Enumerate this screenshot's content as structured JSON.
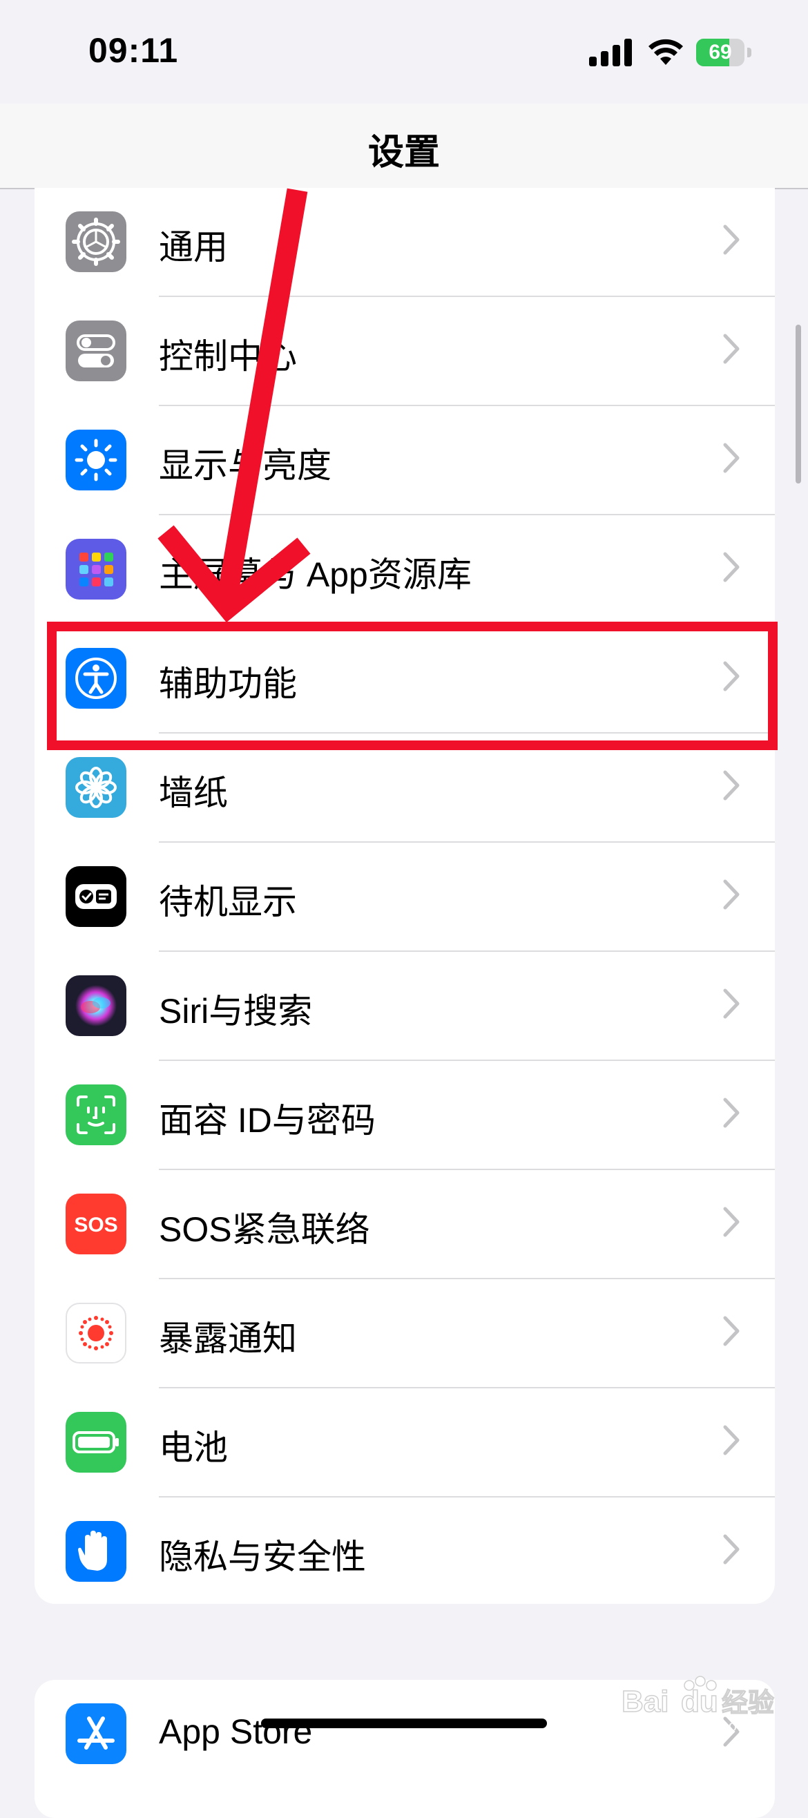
{
  "status_bar": {
    "time": "09:11",
    "battery_percent": "69",
    "battery_level": 0.69
  },
  "nav": {
    "title": "设置"
  },
  "settings_items": [
    {
      "label": "通用",
      "icon": "gear-icon",
      "icon_bg": "#8e8e93"
    },
    {
      "label": "控制中心",
      "icon": "toggle-switches-icon",
      "icon_bg": "#8e8e93"
    },
    {
      "label": "显示与亮度",
      "icon": "sun-icon",
      "icon_bg": "#007aff"
    },
    {
      "label": "主屏幕与 App资源库",
      "icon": "app-grid-icon",
      "icon_bg": "#5e5ce6"
    },
    {
      "label": "辅助功能",
      "icon": "accessibility-icon",
      "icon_bg": "#007aff"
    },
    {
      "label": "墙纸",
      "icon": "flower-icon",
      "icon_bg": "#35aadc"
    },
    {
      "label": "待机显示",
      "icon": "standby-icon",
      "icon_bg": "#000000"
    },
    {
      "label": "Siri与搜索",
      "icon": "siri-icon",
      "icon_bg": "#1c1c2e"
    },
    {
      "label": "面容 ID与密码",
      "icon": "face-id-icon",
      "icon_bg": "#34c759"
    },
    {
      "label": "SOS紧急联络",
      "icon": "sos-icon",
      "icon_bg": "#ff3b30"
    },
    {
      "label": "暴露通知",
      "icon": "exposure-notification-icon",
      "icon_bg": "#ffffff"
    },
    {
      "label": "电池",
      "icon": "battery-icon",
      "icon_bg": "#34c759"
    },
    {
      "label": "隐私与安全性",
      "icon": "hand-icon",
      "icon_bg": "#007aff"
    }
  ],
  "next_group": [
    {
      "label": "App Store",
      "icon": "app-store-icon",
      "icon_bg": "#0a84ff"
    }
  ],
  "annotation": {
    "highlight_color": "#f0102a",
    "highlighted_item": "辅助功能"
  },
  "watermark": {
    "text": "jingyan.baidu.com"
  }
}
